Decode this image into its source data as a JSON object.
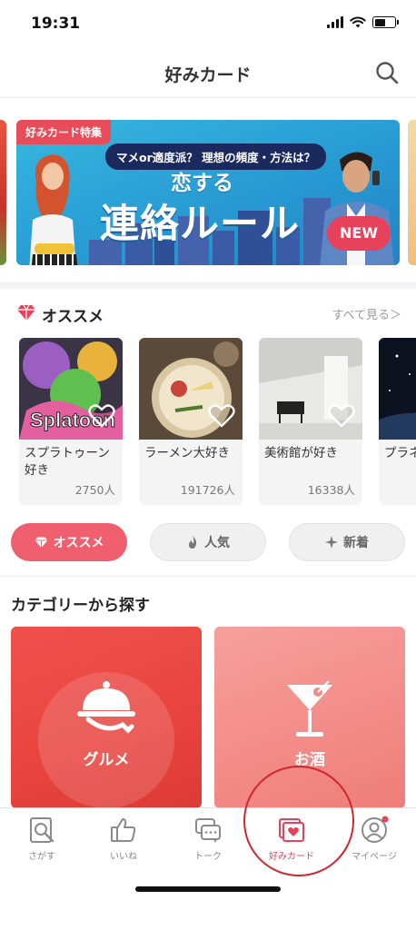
{
  "status_bar": {
    "time": "19:31"
  },
  "header": {
    "title": "好みカード"
  },
  "banner": {
    "tag": "好みカード特集",
    "subtitle": "マメor適度派？ 理想の頻度・方法は？",
    "headline_small": "恋する",
    "headline_main": "連絡ルール",
    "badge": "NEW"
  },
  "recommend": {
    "title": "オススメ",
    "see_all": "すべて見る＞",
    "cards": [
      {
        "name": "スプラトゥーン好き",
        "count": "2750人"
      },
      {
        "name": "ラーメン大好き",
        "count": "191726人"
      },
      {
        "name": "美術館が好き",
        "count": "16338人"
      },
      {
        "name": "プラネ好き",
        "count": ""
      }
    ]
  },
  "filters": [
    {
      "label": "オススメ",
      "icon": "diamond-icon",
      "active": true
    },
    {
      "label": "人気",
      "icon": "flame-icon",
      "active": false
    },
    {
      "label": "新着",
      "icon": "sparkle-icon",
      "active": false
    }
  ],
  "categories": {
    "title": "カテゴリーから探す",
    "items": [
      {
        "label": "グルメ",
        "icon": "cloche-icon"
      },
      {
        "label": "お酒",
        "icon": "cocktail-icon"
      }
    ]
  },
  "tabbar": {
    "items": [
      {
        "label": "さがす",
        "icon": "search-tab-icon"
      },
      {
        "label": "いいね",
        "icon": "thumbs-up-icon"
      },
      {
        "label": "トーク",
        "icon": "chat-icon"
      },
      {
        "label": "好みカード",
        "icon": "card-icon"
      },
      {
        "label": "マイページ",
        "icon": "person-icon"
      }
    ],
    "active": "好みカード"
  },
  "colors": {
    "accent": "#e8415b",
    "annotation": "#d0242f"
  }
}
